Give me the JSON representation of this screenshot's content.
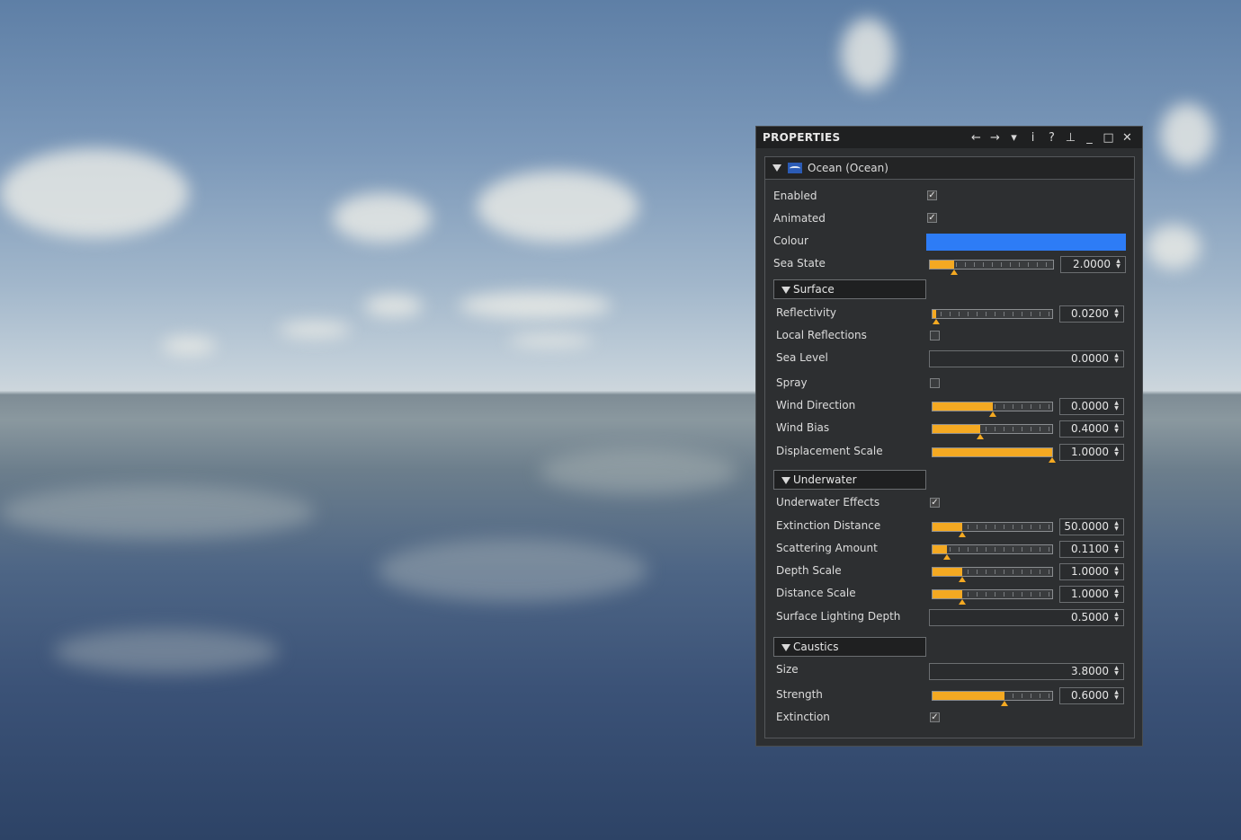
{
  "panel": {
    "title": "PROPERTIES",
    "toolbar_icons": [
      "back-arrow-icon",
      "forward-arrow-icon",
      "dropdown-icon",
      "info-icon",
      "help-icon",
      "pin-icon",
      "minimize-icon",
      "maximize-icon",
      "close-icon"
    ],
    "toolbar_glyphs": {
      "back": "←",
      "forward": "→",
      "dropdown": "▾",
      "info": "i",
      "help": "?",
      "pin": "⊥",
      "minimize": "_",
      "maximize": "□",
      "close": "✕"
    }
  },
  "component": {
    "title": "Ocean (Ocean)",
    "icon": "ocean-flag-icon",
    "enabled": {
      "label": "Enabled",
      "checked": true
    },
    "animated": {
      "label": "Animated",
      "checked": true
    },
    "colour": {
      "label": "Colour",
      "value": "#2d7cf6"
    },
    "sea_state": {
      "label": "Sea State",
      "value": "2.0000",
      "fraction": 0.2
    }
  },
  "surface": {
    "title": "Surface",
    "reflectivity": {
      "label": "Reflectivity",
      "value": "0.0200",
      "fraction": 0.03
    },
    "local_reflections": {
      "label": "Local Reflections",
      "checked": false
    },
    "sea_level": {
      "label": "Sea Level",
      "value": "0.0000"
    },
    "spray": {
      "label": "Spray",
      "checked": false
    },
    "wind_direction": {
      "label": "Wind Direction",
      "value": "0.0000",
      "fraction": 0.5
    },
    "wind_bias": {
      "label": "Wind Bias",
      "value": "0.4000",
      "fraction": 0.4
    },
    "displacement_scale": {
      "label": "Displacement Scale",
      "value": "1.0000",
      "fraction": 1.0
    }
  },
  "underwater": {
    "title": "Underwater",
    "effects": {
      "label": "Underwater Effects",
      "checked": true
    },
    "extinction_distance": {
      "label": "Extinction Distance",
      "value": "50.0000",
      "fraction": 0.25
    },
    "scattering_amount": {
      "label": "Scattering Amount",
      "value": "0.1100",
      "fraction": 0.12
    },
    "depth_scale": {
      "label": "Depth Scale",
      "value": "1.0000",
      "fraction": 0.25
    },
    "distance_scale": {
      "label": "Distance Scale",
      "value": "1.0000",
      "fraction": 0.25
    },
    "surface_lighting_depth": {
      "label": "Surface Lighting Depth",
      "value": "0.5000"
    }
  },
  "caustics": {
    "title": "Caustics",
    "size": {
      "label": "Size",
      "value": "3.8000"
    },
    "strength": {
      "label": "Strength",
      "value": "0.6000",
      "fraction": 0.6
    },
    "extinction": {
      "label": "Extinction",
      "checked": true
    }
  },
  "colors": {
    "slider_fill": "#f4a922",
    "panel_bg": "#2d2f31",
    "titlebar_bg": "#1f2021"
  }
}
